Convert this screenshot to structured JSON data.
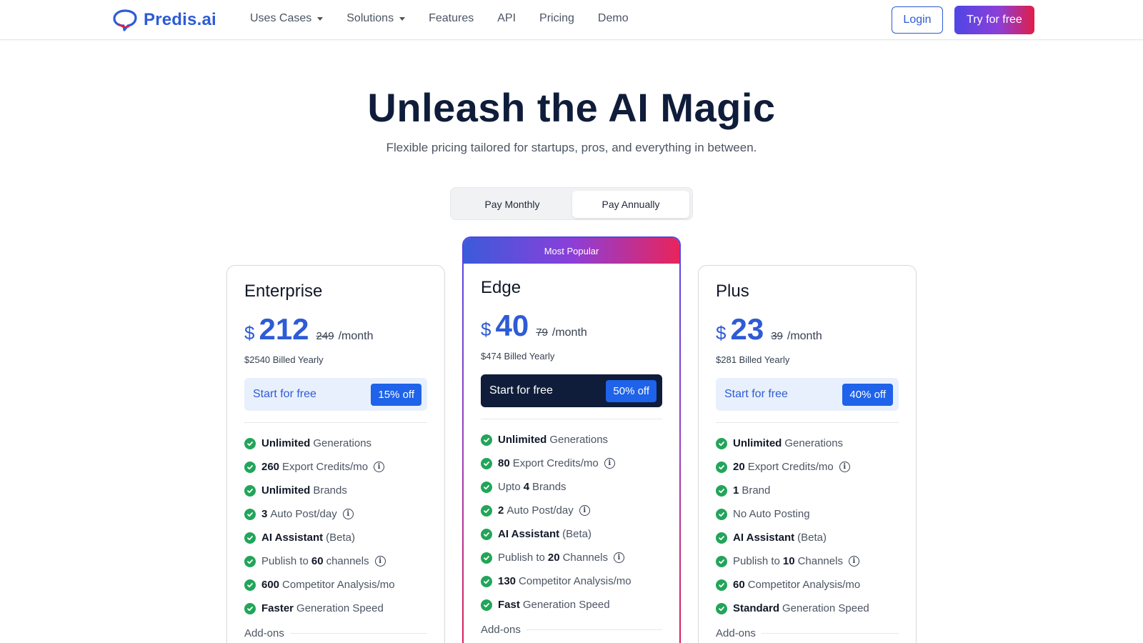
{
  "nav": {
    "logo_text": "Predis.ai",
    "links": [
      {
        "label": "Uses Cases",
        "dropdown": true
      },
      {
        "label": "Solutions",
        "dropdown": true
      },
      {
        "label": "Features",
        "dropdown": false
      },
      {
        "label": "API",
        "dropdown": false
      },
      {
        "label": "Pricing",
        "dropdown": false
      },
      {
        "label": "Demo",
        "dropdown": false
      }
    ],
    "login_label": "Login",
    "try_label": "Try for free"
  },
  "hero": {
    "title": "Unleash the AI Magic",
    "subtitle": "Flexible pricing tailored for startups, pros, and everything in between."
  },
  "billing_toggle": {
    "monthly": "Pay Monthly",
    "annually": "Pay Annually",
    "selected": "annually"
  },
  "plans": {
    "enterprise": {
      "name": "Enterprise",
      "currency": "$",
      "price": "212",
      "old_price": "249",
      "per": "/month",
      "billed": "$2540 Billed Yearly",
      "cta": "Start for free",
      "discount": "15% off",
      "features": [
        {
          "pre": "",
          "bold": "Unlimited",
          "post": "Generations"
        },
        {
          "pre": "",
          "bold": "260",
          "post": "Export Credits/mo",
          "info": true
        },
        {
          "pre": "",
          "bold": "Unlimited",
          "post": "Brands"
        },
        {
          "pre": "",
          "bold": "3",
          "post": "Auto Post/day",
          "info": true
        },
        {
          "pre": "",
          "bold": "AI Assistant",
          "post": "(Beta)"
        },
        {
          "pre": "Publish to",
          "bold": "60",
          "post": "channels",
          "info": true
        },
        {
          "pre": "",
          "bold": "600",
          "post": "Competitor Analysis/mo"
        },
        {
          "pre": "",
          "bold": "Faster",
          "post": "Generation Speed"
        }
      ],
      "addons": "Add-ons"
    },
    "edge": {
      "badge": "Most Popular",
      "name": "Edge",
      "currency": "$",
      "price": "40",
      "old_price": "79",
      "per": "/month",
      "billed": "$474 Billed Yearly",
      "cta": "Start for free",
      "discount": "50% off",
      "features": [
        {
          "pre": "",
          "bold": "Unlimited",
          "post": "Generations"
        },
        {
          "pre": "",
          "bold": "80",
          "post": "Export Credits/mo",
          "info": true
        },
        {
          "pre": "Upto",
          "bold": "4",
          "post": "Brands"
        },
        {
          "pre": "",
          "bold": "2",
          "post": "Auto Post/day",
          "info": true
        },
        {
          "pre": "",
          "bold": "AI Assistant",
          "post": "(Beta)"
        },
        {
          "pre": "Publish to",
          "bold": "20",
          "post": "Channels",
          "info": true
        },
        {
          "pre": "",
          "bold": "130",
          "post": "Competitor Analysis/mo"
        },
        {
          "pre": "",
          "bold": "Fast",
          "post": "Generation Speed"
        }
      ],
      "addons": "Add-ons"
    },
    "plus": {
      "name": "Plus",
      "currency": "$",
      "price": "23",
      "old_price": "39",
      "per": "/month",
      "billed": "$281 Billed Yearly",
      "cta": "Start for free",
      "discount": "40% off",
      "features": [
        {
          "pre": "",
          "bold": "Unlimited",
          "post": "Generations"
        },
        {
          "pre": "",
          "bold": "20",
          "post": "Export Credits/mo",
          "info": true
        },
        {
          "pre": "",
          "bold": "1",
          "post": "Brand"
        },
        {
          "pre": "No Auto Posting",
          "bold": "",
          "post": ""
        },
        {
          "pre": "",
          "bold": "AI Assistant",
          "post": "(Beta)"
        },
        {
          "pre": "Publish to",
          "bold": "10",
          "post": "Channels",
          "info": true
        },
        {
          "pre": "",
          "bold": "60",
          "post": "Competitor Analysis/mo"
        },
        {
          "pre": "",
          "bold": "Standard",
          "post": "Generation Speed"
        }
      ],
      "addons": "Add-ons"
    }
  },
  "colors": {
    "brand_blue": "#2e5bd6",
    "navy": "#0f1d3a",
    "check_green": "#22a55a",
    "badge_blue": "#1e63e9"
  }
}
